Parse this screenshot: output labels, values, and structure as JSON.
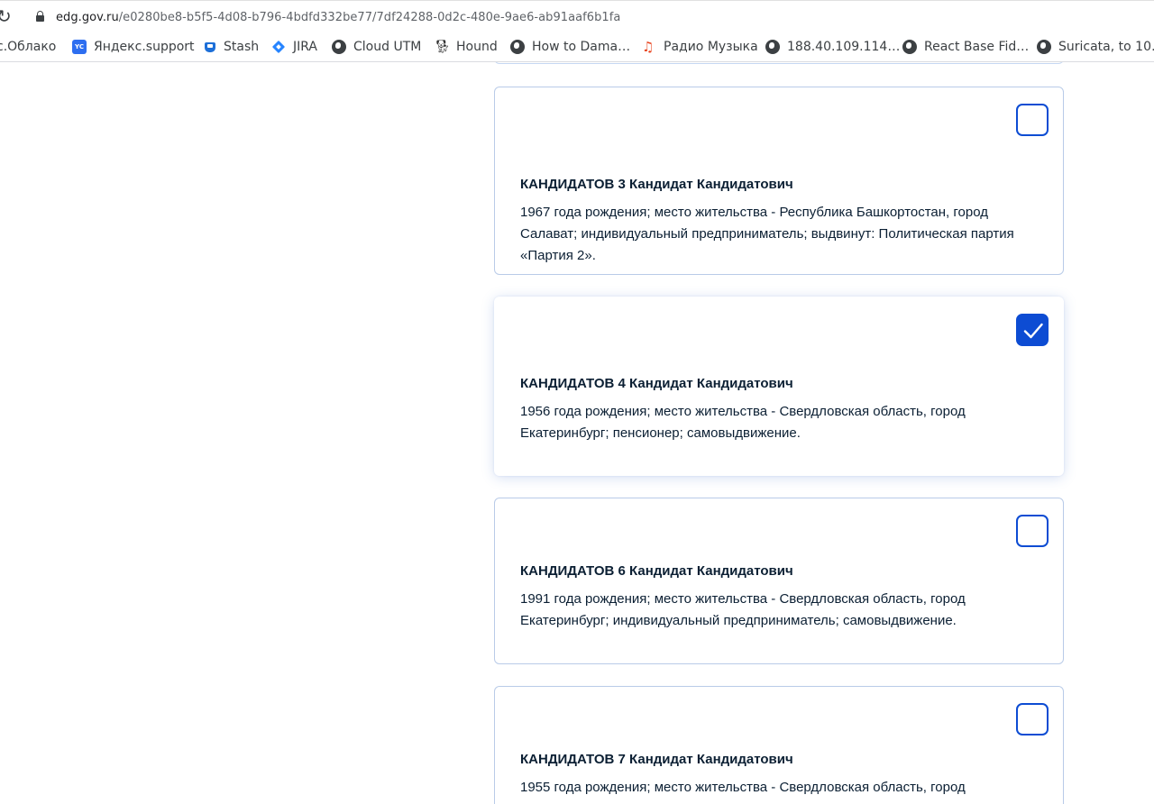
{
  "browser": {
    "url_host": "edg.gov.ru",
    "url_path": "/e0280be8-b5f5-4d08-b796-4bdfd332be77/7df24288-0d2c-480e-9ae6-ab91aaf6b1fa",
    "bookmarks": [
      {
        "label": "с.Облако",
        "icon": "none"
      },
      {
        "label": "Яндекс.support",
        "icon": "yc-icon"
      },
      {
        "label": "Stash",
        "icon": "stash-icon"
      },
      {
        "label": "JIRA",
        "icon": "jira-icon"
      },
      {
        "label": "Cloud UTM",
        "icon": "globe-icon"
      },
      {
        "label": "Hound",
        "icon": "hound-icon"
      },
      {
        "label": "How to Dama…",
        "icon": "globe-icon"
      },
      {
        "label": "Радио Музыка",
        "icon": "music-note-icon"
      },
      {
        "label": "188.40.109.114…",
        "icon": "globe-icon"
      },
      {
        "label": "React Base Fid…",
        "icon": "globe-icon"
      },
      {
        "label": "Suricata, to 10…",
        "icon": "globe-icon"
      }
    ]
  },
  "candidates": [
    {
      "name": "КАНДИДАТОВ 3 Кандидат Кандидатович",
      "description": "1967 года рождения; место жительства - Республика Башкортостан, город Салават; индивидуальный предприниматель; выдвинут: Политическая партия «Партия 2».",
      "selected": false
    },
    {
      "name": "КАНДИДАТОВ 4 Кандидат Кандидатович",
      "description": "1956 года рождения; место жительства - Свердловская область, город Екатеринбург; пенсионер; самовыдвижение.",
      "selected": true
    },
    {
      "name": "КАНДИДАТОВ 6 Кандидат Кандидатович",
      "description": "1991 года рождения; место жительства - Свердловская область, город Екатеринбург; индивидуальный предприниматель; самовыдвижение.",
      "selected": false
    },
    {
      "name": "КАНДИДАТОВ 7 Кандидат Кандидатович",
      "description": "1955 года рождения; место жительства - Свердловская область, город",
      "selected": false
    }
  ],
  "colors": {
    "accent": "#0d4cd3",
    "card_border": "#b9cbe8",
    "text": "#0b1f33"
  }
}
